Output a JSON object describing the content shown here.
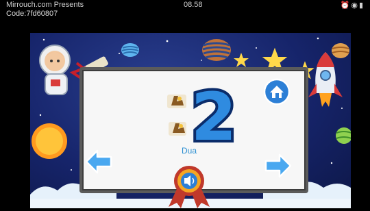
{
  "status_bar": {
    "app_label": "Mirrouch.com Presents",
    "time": "08.58",
    "icons": [
      "alarm-icon",
      "eye-icon",
      "battery-icon"
    ]
  },
  "code_label": "Code:7fd60807",
  "lesson": {
    "numeral": "2",
    "word": "Dua",
    "item_count": 2
  },
  "colors": {
    "numeral_fill": "#2f8be0",
    "numeral_outline": "#0b2c6a",
    "arrow_fill": "#4aa8f0",
    "home_fill": "#2c7fd6",
    "sky": "#16246a"
  }
}
